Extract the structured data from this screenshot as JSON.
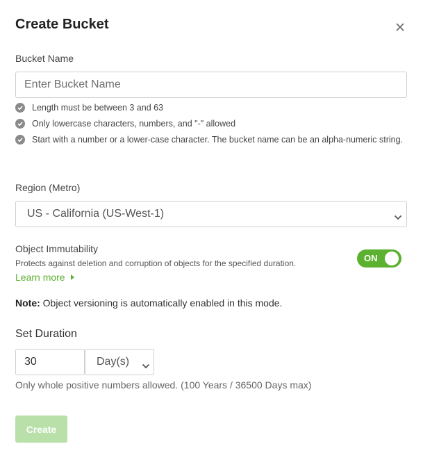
{
  "dialog": {
    "title": "Create Bucket",
    "close_icon": "close-icon"
  },
  "bucket_name": {
    "label": "Bucket Name",
    "value": "",
    "placeholder": "Enter Bucket Name",
    "rules": [
      "Length must be between 3 and 63",
      "Only lowercase characters, numbers, and \"-\" allowed",
      "Start with a number or a lower-case character. The bucket name can be an alpha-numeric string."
    ],
    "rule_icon": "check-circle-icon"
  },
  "region": {
    "label": "Region (Metro)",
    "selected": "US - California (US-West-1)",
    "chevron_icon": "chevron-down-icon"
  },
  "immutability": {
    "label": "Object Immutability",
    "description": "Protects against deletion and corruption of objects for the specified duration.",
    "learn_more": "Learn more",
    "learn_more_icon": "caret-right-icon",
    "toggle_label": "ON",
    "toggle_state": true,
    "accent_color": "#5cb130"
  },
  "note": {
    "prefix": "Note:",
    "text": "Object versioning is automatically enabled in this mode."
  },
  "duration": {
    "label": "Set Duration",
    "value": "30",
    "unit_selected": "Day(s)",
    "hint": "Only whole positive numbers allowed. (100 Years / 36500 Days max)"
  },
  "actions": {
    "create_label": "Create",
    "create_enabled": false,
    "create_color": "#b8e0a8"
  }
}
